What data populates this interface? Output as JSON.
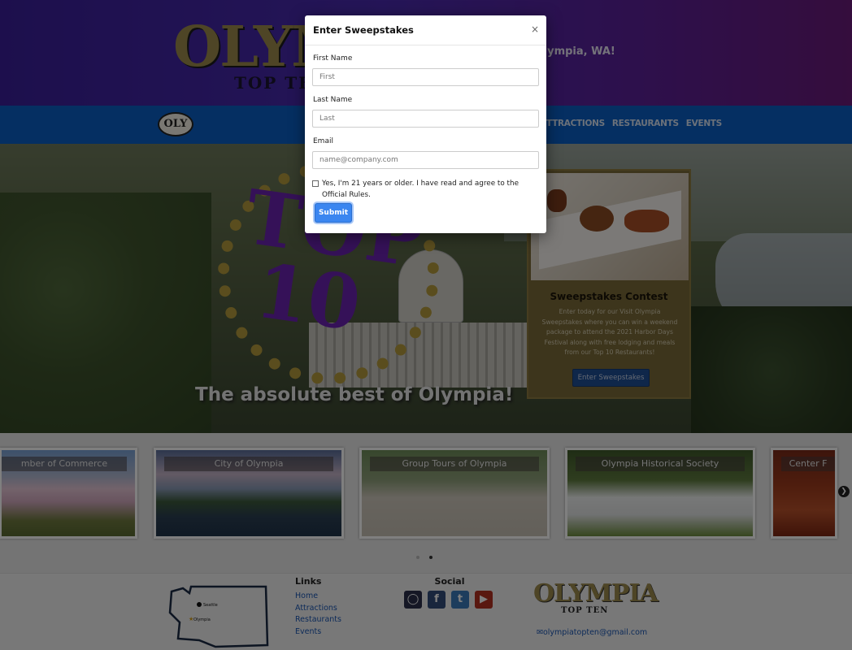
{
  "header": {
    "logo_word": "OLYMPIA",
    "logo_sub": "TOP TEN",
    "tagline": "ts of Olympia, WA!"
  },
  "nav": {
    "logo_text": "OLY",
    "links": [
      "TTRACTIONS",
      "RESTAURANTS",
      "EVENTS"
    ]
  },
  "hero": {
    "badge_line1": "TOP",
    "badge_line2": "10",
    "caption": "The absolute best of Olympia!"
  },
  "sweepstakes_card": {
    "title": "Sweepstakes Contest",
    "description": "Enter today for our Visit Olympia Sweepstakes where you can win a weekend package to attend the 2021 Harbor Days Festival along with free lodging and meals from our Top 10 Restaurants!",
    "button_label": "Enter Sweepstakes"
  },
  "carousel": {
    "prev_icon": "chevron-left-icon",
    "next_icon": "chevron-right-icon",
    "slides": [
      {
        "label": "mber of Commerce"
      },
      {
        "label": "City of Olympia"
      },
      {
        "label": "Group Tours of Olympia"
      },
      {
        "label": "Olympia Historical Society"
      },
      {
        "label": "Center F"
      }
    ],
    "active_dot": 1
  },
  "footer": {
    "map_labels": {
      "city1": "Seattle",
      "city2": "Olympia"
    },
    "links_heading": "Links",
    "links": [
      "Home",
      "Attractions",
      "Restaurants",
      "Events"
    ],
    "social_heading": "Social",
    "social_icons": [
      "instagram-icon",
      "facebook-icon",
      "twitter-icon",
      "youtube-icon"
    ],
    "logo_word": "OLYMPIA",
    "logo_sub": "TOP TEN",
    "email": "olympiatopten@gmail.com"
  },
  "modal": {
    "title": "Enter Sweepstakes",
    "close_symbol": "×",
    "first_name_label": "First Name",
    "first_name_placeholder": "First",
    "first_name_value": "",
    "last_name_label": "Last Name",
    "last_name_placeholder": "Last",
    "last_name_value": "",
    "email_label": "Email",
    "email_placeholder": "name@company.com",
    "email_value": "",
    "consent_text": "Yes, I'm 21 years or older. I have read and agree to the Official Rules.",
    "submit_label": "Submit"
  },
  "colors": {
    "header_gradient_start": "#3a1f9a",
    "nav_blue": "#0a5ec4",
    "gold": "#9c8a4c",
    "submit_blue": "#3b86f0"
  }
}
